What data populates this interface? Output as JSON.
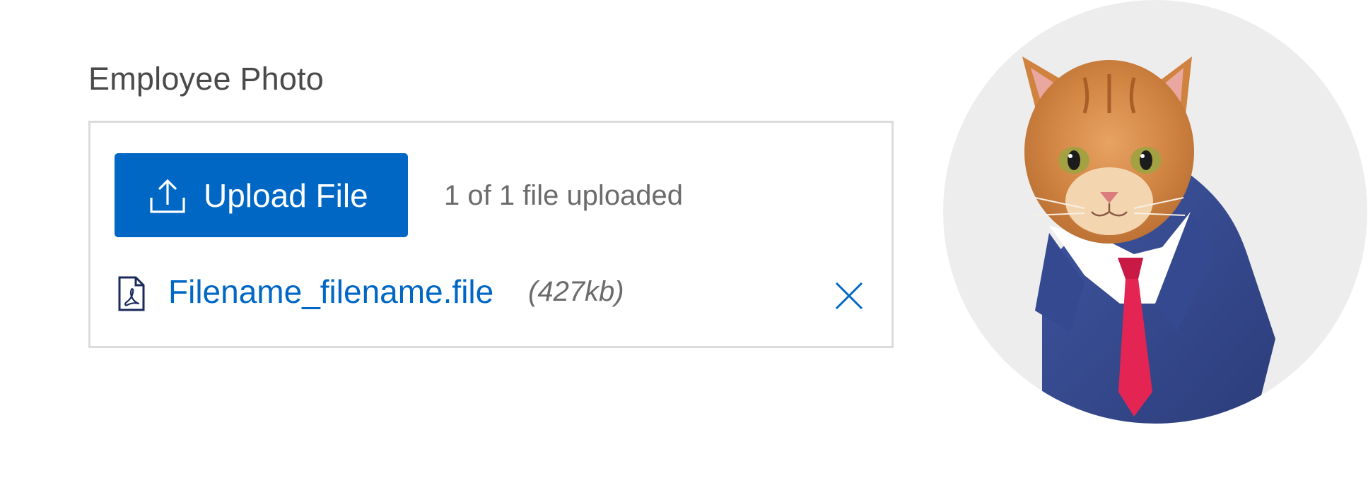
{
  "field": {
    "title": "Employee Photo"
  },
  "upload": {
    "button_label": "Upload File",
    "button_icon": "upload-icon",
    "status": "1 of 1 file uploaded",
    "accent_color": "#0067c5"
  },
  "file": {
    "icon": "pdf-file-icon",
    "name": "Filename_filename.file",
    "size": "(427kb)",
    "remove_icon": "close-icon"
  },
  "photo": {
    "subject": "cat-in-suit-photo",
    "background": "#ededed"
  }
}
